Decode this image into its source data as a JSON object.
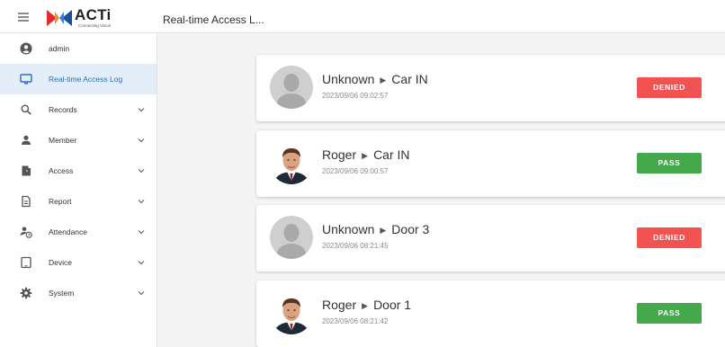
{
  "header": {
    "logo_text": "ACTi",
    "logo_tagline": "Connecting Vision",
    "page_title": "Real-time Access L..."
  },
  "sidebar": {
    "items": [
      {
        "label": "admin",
        "icon": "account-circle-icon"
      },
      {
        "label": "Real-time Access Log",
        "icon": "monitor-icon",
        "active": true
      },
      {
        "label": "Records",
        "icon": "search-icon"
      },
      {
        "label": "Member",
        "icon": "person-icon"
      },
      {
        "label": "Access",
        "icon": "door-icon"
      },
      {
        "label": "Report",
        "icon": "document-icon"
      },
      {
        "label": "Attendance",
        "icon": "person-clock-icon"
      },
      {
        "label": "Device",
        "icon": "tablet-icon"
      },
      {
        "label": "System",
        "icon": "gear-icon"
      }
    ]
  },
  "access_log": [
    {
      "name": "Unknown",
      "event": "Car IN",
      "time": "2023/09/06 09:02:57",
      "status": "DENIED",
      "avatar": "placeholder"
    },
    {
      "name": "Roger",
      "event": "Car IN",
      "time": "2023/09/06 09:00:57",
      "status": "PASS",
      "avatar": "photo"
    },
    {
      "name": "Unknown",
      "event": "Door 3",
      "time": "2023/09/06 08:21:45",
      "status": "DENIED",
      "avatar": "placeholder"
    },
    {
      "name": "Roger",
      "event": "Door 1",
      "time": "2023/09/06 08:21:42",
      "status": "PASS",
      "avatar": "photo"
    }
  ],
  "colors": {
    "active_nav_bg": "#e3eef9",
    "active_nav_text": "#2f6dc1",
    "denied": "#f25252",
    "pass": "#43a94a",
    "logo_red": "#e8272c",
    "logo_blue": "#1d4f9c"
  }
}
